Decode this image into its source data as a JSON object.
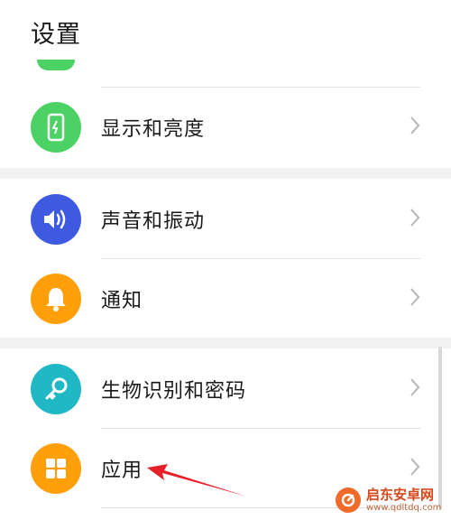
{
  "header": {
    "title": "设置"
  },
  "settings": {
    "display": {
      "label": "显示和亮度",
      "icon": "phone-brightness-icon",
      "color": "#4cd264"
    },
    "sound": {
      "label": "声音和振动",
      "icon": "speaker-icon",
      "color": "#3e5ae0"
    },
    "notifications": {
      "label": "通知",
      "icon": "bell-icon",
      "color": "#ff9f0a"
    },
    "biometrics": {
      "label": "生物识别和密码",
      "icon": "key-icon",
      "color": "#20b8c4"
    },
    "apps": {
      "label": "应用",
      "icon": "grid-icon",
      "color": "#ff9f0a"
    }
  },
  "colors": {
    "section_gap": "#f1f1f1",
    "divider": "#e2e2e2",
    "chevron": "#b5b5b5",
    "arrow": "#e6212a"
  },
  "watermark": {
    "name": "启东安卓网",
    "url": "www.qdltdq.com"
  }
}
